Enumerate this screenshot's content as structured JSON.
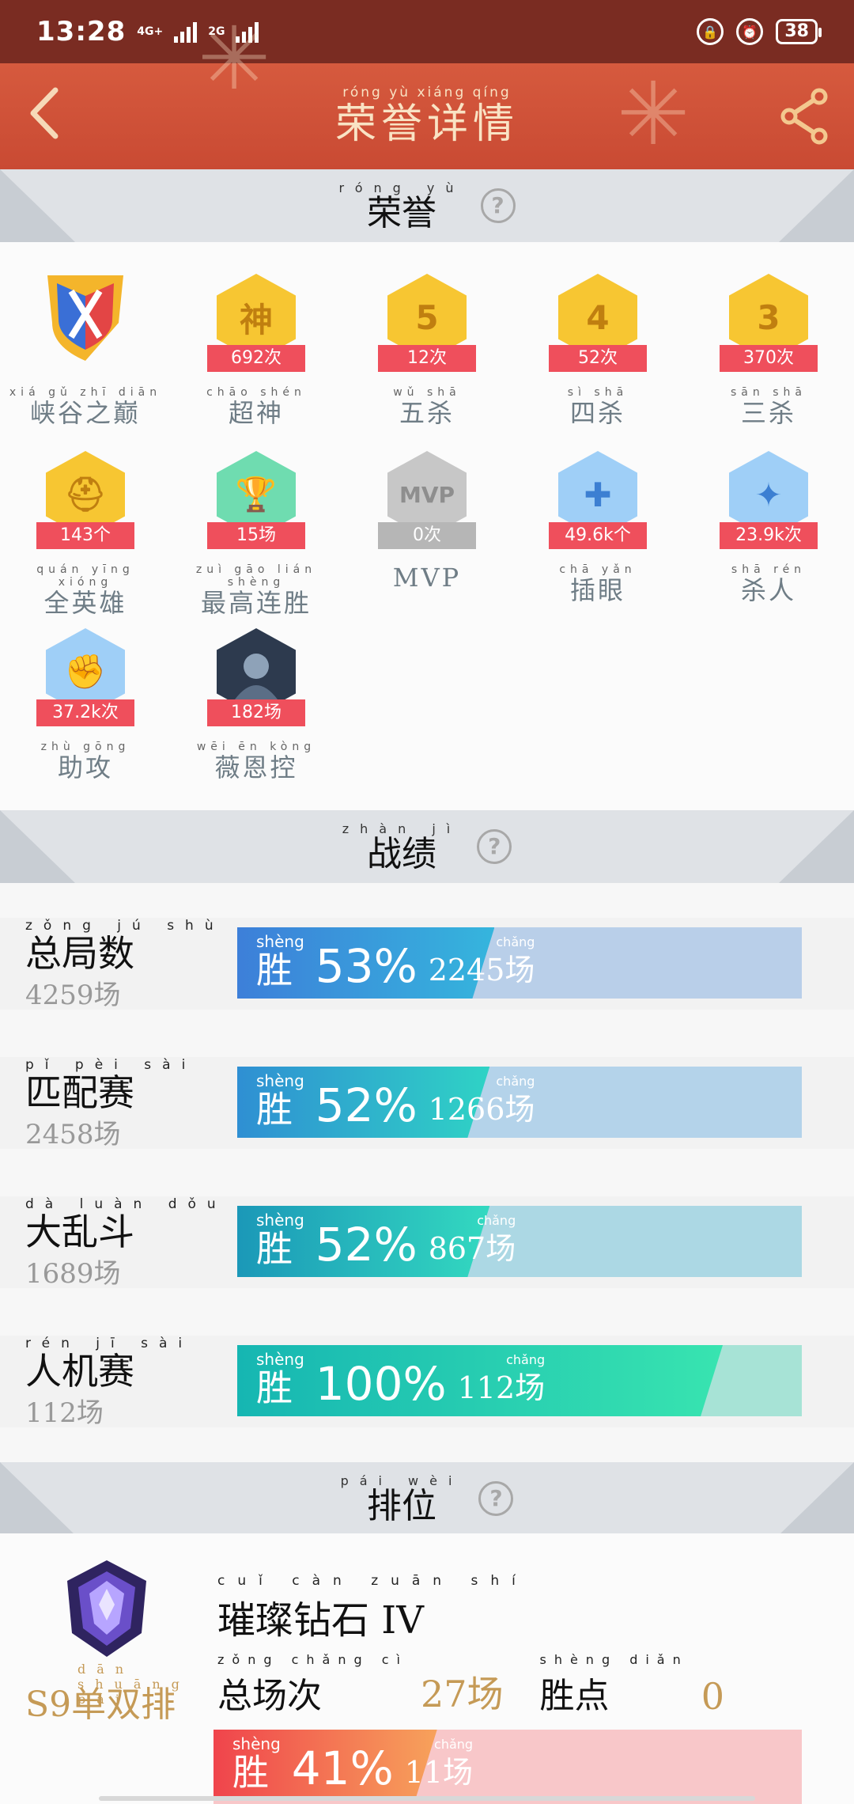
{
  "status": {
    "time": "13:28",
    "net1": "4G+",
    "net2": "2G",
    "battery": "38"
  },
  "header": {
    "title_pinyin": "róng yù xiáng qíng",
    "title": "荣誉详情"
  },
  "sections": {
    "honor": {
      "pinyin": "róng yù",
      "title": "荣誉",
      "help": "?"
    },
    "record": {
      "pinyin": "zhàn jì",
      "title": "战绩",
      "help": "?"
    },
    "rank": {
      "pinyin": "pái wèi",
      "title": "排位",
      "help": "?"
    }
  },
  "honors": [
    {
      "pinyin": "xiá gǔ zhī diān",
      "name": "峡谷之巅",
      "count": "",
      "icon": "peak-emblem-icon"
    },
    {
      "pinyin": "chāo shén",
      "name": "超神",
      "count": "692次",
      "icon": "god-badge-icon",
      "glyph": "神"
    },
    {
      "pinyin": "wǔ shā",
      "name": "五杀",
      "count": "12次",
      "icon": "penta-kill-badge-icon",
      "glyph": "5"
    },
    {
      "pinyin": "sì shā",
      "name": "四杀",
      "count": "52次",
      "icon": "quadra-kill-badge-icon",
      "glyph": "4"
    },
    {
      "pinyin": "sān shā",
      "name": "三杀",
      "count": "370次",
      "icon": "triple-kill-badge-icon",
      "glyph": "3"
    },
    {
      "pinyin": "quán yīng xióng",
      "name": "全英雄",
      "count": "143个",
      "icon": "helmet-badge-icon",
      "glyph": "⛑"
    },
    {
      "pinyin": "zuì gāo lián shèng",
      "name": "最高连胜",
      "count": "15场",
      "icon": "trophy-badge-icon",
      "glyph": "🏆"
    },
    {
      "pinyin": "",
      "name": "MVP",
      "count": "0次",
      "icon": "mvp-badge-icon",
      "glyph": "MVP"
    },
    {
      "pinyin": "chā yǎn",
      "name": "插眼",
      "count": "49.6k个",
      "icon": "ward-badge-icon",
      "glyph": "✚"
    },
    {
      "pinyin": "shā rén",
      "name": "杀人",
      "count": "23.9k次",
      "icon": "kill-badge-icon",
      "glyph": "✦"
    },
    {
      "pinyin": "zhù gōng",
      "name": "助攻",
      "count": "37.2k次",
      "icon": "assist-badge-icon",
      "glyph": "✊"
    },
    {
      "pinyin": "wēi ēn kòng",
      "name": "薇恩控",
      "count": "182场",
      "icon": "vayne-avatar-icon",
      "glyph": ""
    }
  ],
  "records": [
    {
      "pinyin": "zǒng jú shù",
      "label": "总局数",
      "total": "4259场",
      "win_label": "胜",
      "rate": "53%",
      "games": "2245场",
      "rate_value": 0.53
    },
    {
      "pinyin": "pǐ pèi sài",
      "label": "匹配赛",
      "total": "2458场",
      "win_label": "胜",
      "rate": "52%",
      "games": "1266场",
      "rate_value": 0.52
    },
    {
      "pinyin": "dà luàn dǒu",
      "label": "大乱斗",
      "total": "1689场",
      "win_label": "胜",
      "rate": "52%",
      "games": "867场",
      "rate_value": 0.52
    },
    {
      "pinyin": "rén jī sài",
      "label": "人机赛",
      "total": "112场",
      "win_label": "胜",
      "rate": "100%",
      "games": "112场",
      "rate_value": 1.0
    }
  ],
  "rank": {
    "tier_pinyin": "cuǐ càn zuān shí",
    "tier": "璀璨钻石 IV",
    "season": "S9单双排",
    "season_pinyin": "dān shuāng pái",
    "games_pinyin": "zǒng chǎng cì",
    "games_label": "总场次",
    "games_value": "27场",
    "points_pinyin": "shèng diǎn",
    "points_label": "胜点",
    "points_value": "0",
    "win_label": "胜",
    "rate": "41%",
    "wins": "11场",
    "rate_value": 0.41
  },
  "colors": {
    "header": "#d05037",
    "ribbon": "#ef4f5c",
    "gold_text": "#c59a56"
  }
}
